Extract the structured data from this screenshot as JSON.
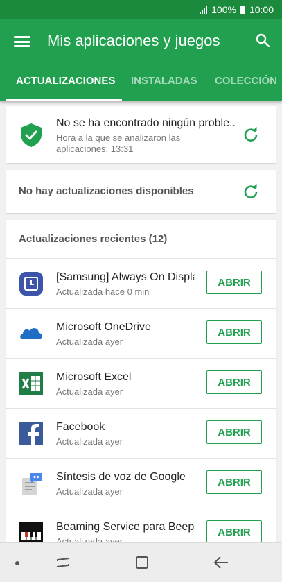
{
  "status_bar": {
    "battery": "100%",
    "time": "10:00"
  },
  "app_bar": {
    "title": "Mis aplicaciones y juegos"
  },
  "tabs": [
    {
      "label": "ACTUALIZACIONES",
      "active": true
    },
    {
      "label": "INSTALADAS",
      "active": false
    },
    {
      "label": "COLECCIÓN",
      "active": false
    }
  ],
  "security_card": {
    "title": "No se ha encontrado ningún proble..",
    "subtitle": "Hora a la que se analizaron las aplicaciones: 13:31"
  },
  "updates_card": {
    "text": "No hay actualizaciones disponibles"
  },
  "recent": {
    "header": "Actualizaciones recientes (12)",
    "items": [
      {
        "name": "[Samsung] Always On Display",
        "status": "Actualizada hace 0 min",
        "button": "ABRIR",
        "icon": "clock-icon"
      },
      {
        "name": "Microsoft OneDrive",
        "status": "Actualizada ayer",
        "button": "ABRIR",
        "icon": "cloud-icon"
      },
      {
        "name": "Microsoft Excel",
        "status": "Actualizada ayer",
        "button": "ABRIR",
        "icon": "excel-icon"
      },
      {
        "name": "Facebook",
        "status": "Actualizada ayer",
        "button": "ABRIR",
        "icon": "facebook-icon"
      },
      {
        "name": "Síntesis de voz de Google",
        "status": "Actualizada ayer",
        "button": "ABRIR",
        "icon": "speech-icon"
      },
      {
        "name": "Beaming Service para Beep'n Go",
        "status": "Actualizada ayer",
        "button": "ABRIR",
        "icon": "piano-icon"
      }
    ]
  },
  "colors": {
    "status_bar": "#1c8a3d",
    "app_bar": "#21a150",
    "accent": "#21a150"
  }
}
